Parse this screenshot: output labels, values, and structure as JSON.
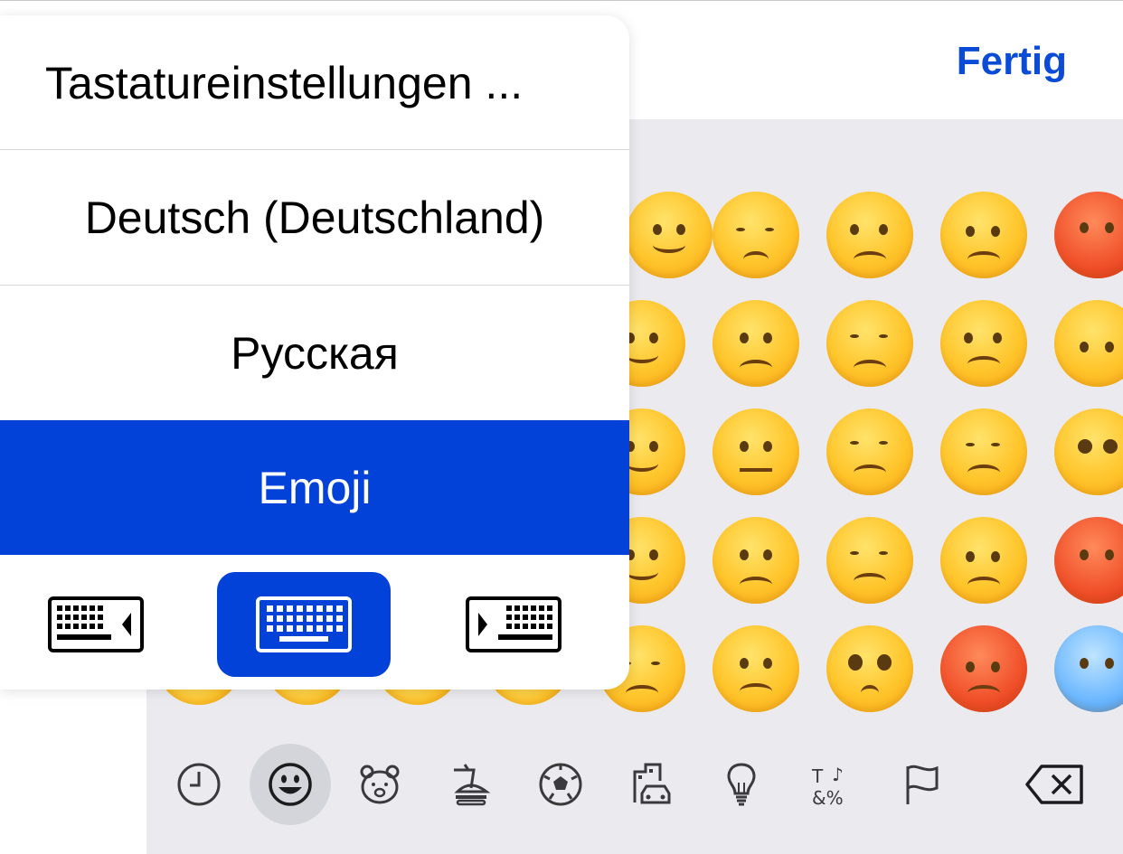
{
  "header": {
    "done_label": "Fertig"
  },
  "menu": {
    "items": [
      {
        "label": "Tastatureinstellungen ...",
        "selected": false
      },
      {
        "label": "Deutsch (Deutschland)",
        "selected": false
      },
      {
        "label": "Русская",
        "selected": false
      },
      {
        "label": "Emoji",
        "selected": true
      }
    ],
    "keyboard_modes": [
      {
        "icon": "keyboard-left-icon",
        "selected": false
      },
      {
        "icon": "keyboard-full-icon",
        "selected": true
      },
      {
        "icon": "keyboard-right-icon",
        "selected": false
      }
    ]
  },
  "emoji_categories": [
    {
      "icon": "clock-icon",
      "name": "recent",
      "selected": false
    },
    {
      "icon": "smiley-icon",
      "name": "smileys",
      "selected": true
    },
    {
      "icon": "bear-icon",
      "name": "animals",
      "selected": false
    },
    {
      "icon": "burger-icon",
      "name": "food",
      "selected": false
    },
    {
      "icon": "soccer-ball-icon",
      "name": "activity",
      "selected": false
    },
    {
      "icon": "building-car-icon",
      "name": "travel",
      "selected": false
    },
    {
      "icon": "lightbulb-icon",
      "name": "objects",
      "selected": false
    },
    {
      "icon": "symbols-icon",
      "name": "symbols",
      "selected": false
    },
    {
      "icon": "flag-icon",
      "name": "flags",
      "selected": false
    }
  ],
  "delete_icon": "backspace-icon",
  "colors": {
    "accent": "#0342d8",
    "done_text": "#0a4cd6",
    "keyboard_bg": "#ebebef"
  }
}
